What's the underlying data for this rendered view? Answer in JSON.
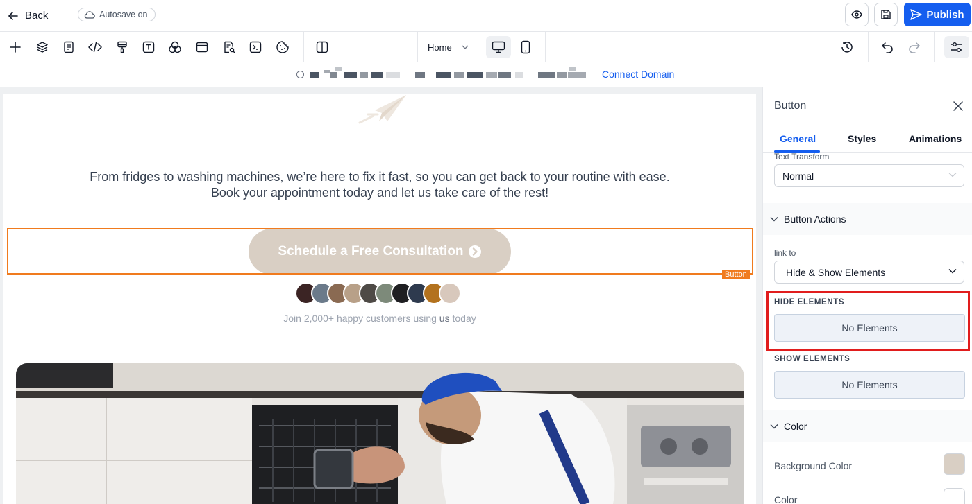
{
  "topbar": {
    "back_label": "Back",
    "autosave_label": "Autosave on",
    "publish_label": "Publish"
  },
  "toolbar": {
    "page_selected": "Home",
    "icons": [
      "plus-icon",
      "layers-icon",
      "pages-icon",
      "code-icon",
      "brush-icon",
      "text-icon",
      "colors-icon",
      "section-icon",
      "seo-icon",
      "terminal-icon",
      "cookie-icon",
      "split-view-icon",
      "desktop-icon",
      "mobile-icon",
      "history-icon",
      "undo-icon",
      "redo-icon",
      "settings-icon"
    ]
  },
  "urlbar": {
    "connect_domain_label": "Connect Domain"
  },
  "canvas": {
    "text_line1": "From fridges to washing machines, we’re here to fix it fast, so you can get back to your routine with ease.",
    "text_line2": "Book your appointment today and let us take care of the rest!",
    "cta_label": "Schedule a Free Consultation",
    "selection_tag": "Button",
    "join_prefix": "Join 2,000+ happy customers using ",
    "join_bold": "us",
    "join_suffix": " today",
    "colors": {
      "accent_orange": "#f07b1e",
      "cta_bg": "#d9cfc4"
    }
  },
  "panel": {
    "title": "Button",
    "tabs": [
      {
        "label": "General",
        "active": true
      },
      {
        "label": "Styles",
        "active": false
      },
      {
        "label": "Animations",
        "active": false
      }
    ],
    "text_transform_label": "Text Transform",
    "text_transform_value": "Normal",
    "button_actions_label": "Button Actions",
    "link_to_label": "link to",
    "link_to_value": "Hide & Show Elements",
    "hide_elements_label": "HIDE ELEMENTS",
    "hide_elements_value": "No Elements",
    "show_elements_label": "SHOW ELEMENTS",
    "show_elements_value": "No Elements",
    "color_section_label": "Color",
    "background_color_label": "Background Color",
    "background_color_value": "#d9cfc4",
    "color_label": "Color",
    "color_value": "#ffffff"
  },
  "theme": {
    "brand_blue": "#155eef",
    "highlight_red": "#e11d1d"
  }
}
